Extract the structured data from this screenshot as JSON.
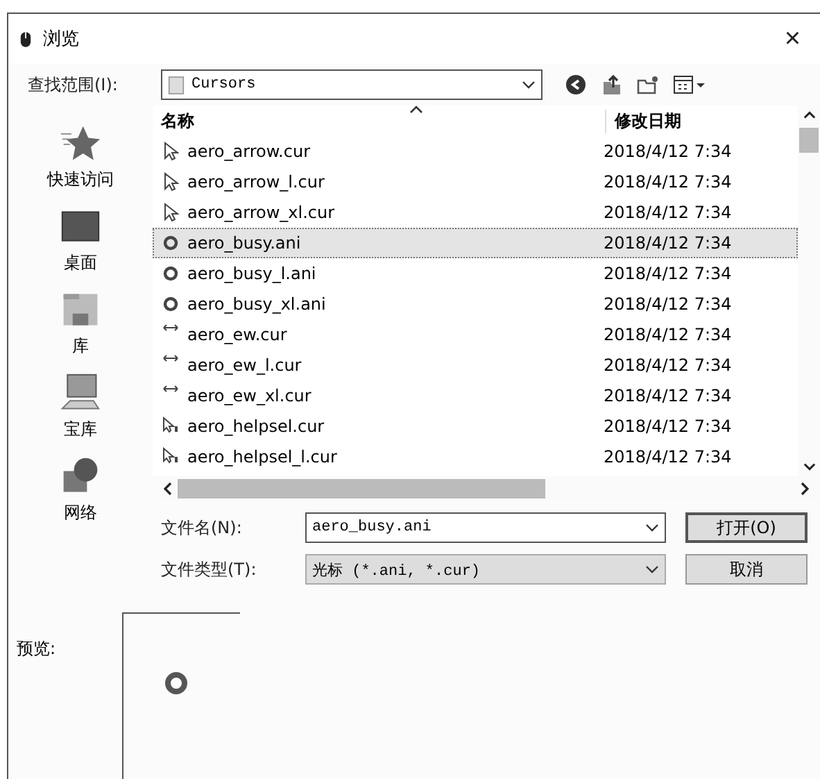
{
  "window": {
    "title": "浏览",
    "close": "×"
  },
  "look_in": {
    "label": "查找范围(I):",
    "value": "Cursors"
  },
  "sidebar": {
    "items": [
      {
        "label": "快速访问",
        "kind": "star"
      },
      {
        "label": "桌面",
        "kind": "desktop"
      },
      {
        "label": "库",
        "kind": "library"
      },
      {
        "label": "宝库",
        "kind": "computer"
      },
      {
        "label": "网络",
        "kind": "network"
      }
    ]
  },
  "table": {
    "columns": [
      "名称",
      "修改日期"
    ],
    "rows": [
      {
        "name": "aero_arrow.cur",
        "date": "2018/4/12 7:34",
        "kind": "arrow",
        "selected": false
      },
      {
        "name": "aero_arrow_l.cur",
        "date": "2018/4/12 7:34",
        "kind": "arrow",
        "selected": false
      },
      {
        "name": "aero_arrow_xl.cur",
        "date": "2018/4/12 7:34",
        "kind": "arrow",
        "selected": false
      },
      {
        "name": "aero_busy.ani",
        "date": "2018/4/12 7:34",
        "kind": "busy",
        "selected": true
      },
      {
        "name": "aero_busy_l.ani",
        "date": "2018/4/12 7:34",
        "kind": "busy",
        "selected": false
      },
      {
        "name": "aero_busy_xl.ani",
        "date": "2018/4/12 7:34",
        "kind": "busy",
        "selected": false
      },
      {
        "name": "aero_ew.cur",
        "date": "2018/4/12 7:34",
        "kind": "ew",
        "selected": false
      },
      {
        "name": "aero_ew_l.cur",
        "date": "2018/4/12 7:34",
        "kind": "ew",
        "selected": false
      },
      {
        "name": "aero_ew_xl.cur",
        "date": "2018/4/12 7:34",
        "kind": "ew",
        "selected": false
      },
      {
        "name": "aero_helpsel.cur",
        "date": "2018/4/12 7:34",
        "kind": "helpsel",
        "selected": false
      },
      {
        "name": "aero_helpsel_l.cur",
        "date": "2018/4/12 7:34",
        "kind": "helpsel",
        "selected": false
      }
    ]
  },
  "file_name": {
    "label": "文件名(N):",
    "value": "aero_busy.ani"
  },
  "file_type": {
    "label": "文件类型(T):",
    "value": "光标 (*.ani, *.cur)"
  },
  "buttons": [
    "打开(O)",
    "取消"
  ],
  "preview": {
    "label": "预览:"
  }
}
